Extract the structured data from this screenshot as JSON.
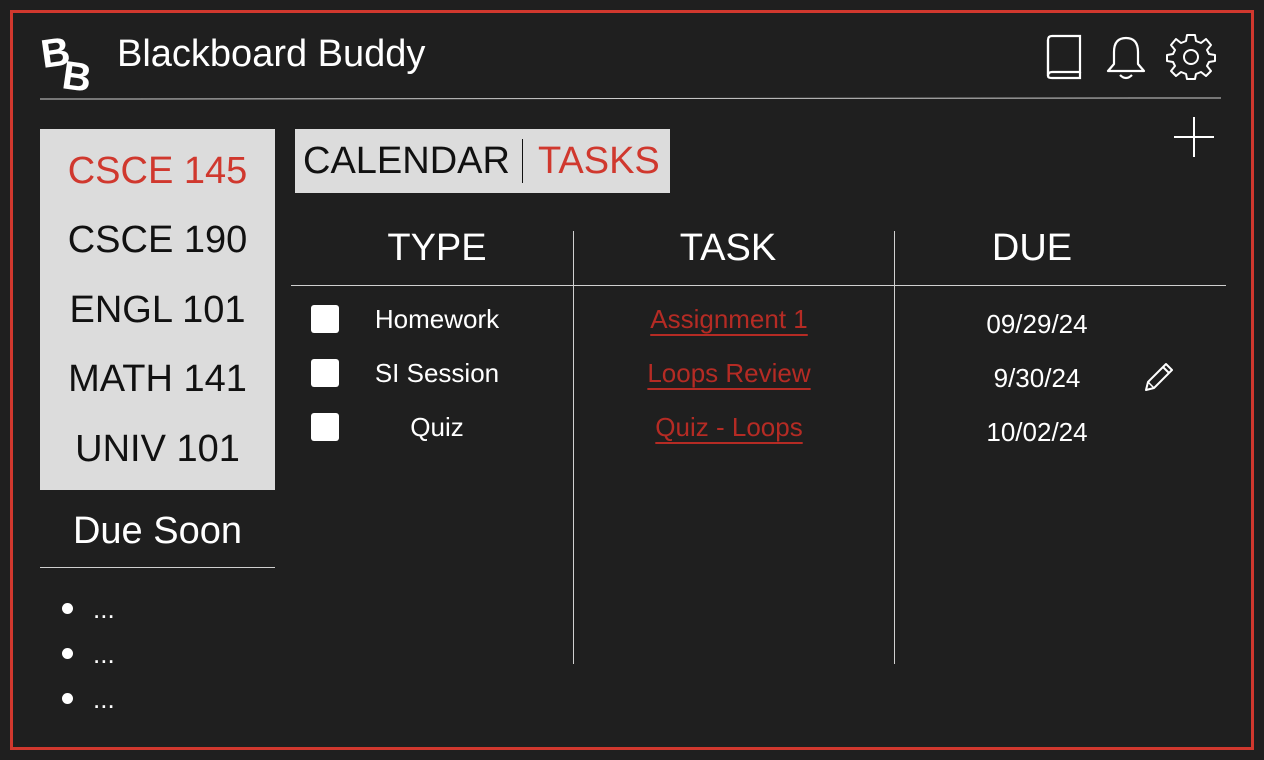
{
  "app": {
    "title": "Blackboard Buddy",
    "accent_color": "#d0382e",
    "logo_letters": "BB"
  },
  "header": {
    "icons": [
      "book-icon",
      "bell-icon",
      "gear-icon"
    ]
  },
  "courses": [
    {
      "label": "CSCE 145",
      "active": true
    },
    {
      "label": "CSCE 190",
      "active": false
    },
    {
      "label": "ENGL 101",
      "active": false
    },
    {
      "label": "MATH 141",
      "active": false
    },
    {
      "label": "UNIV 101",
      "active": false
    }
  ],
  "due_soon": {
    "title": "Due Soon",
    "items": [
      "...",
      "...",
      "..."
    ]
  },
  "tabs": [
    {
      "label": "CALENDAR",
      "active": false
    },
    {
      "label": "TASKS",
      "active": true
    }
  ],
  "table": {
    "headers": [
      "TYPE",
      "TASK",
      "DUE"
    ],
    "rows": [
      {
        "type": "Homework",
        "task": "Assignment 1",
        "due": "09/29/24",
        "checked": false
      },
      {
        "type": "SI Session",
        "task": "Loops Review",
        "due": "9/30/24",
        "checked": false
      },
      {
        "type": "Quiz",
        "task": "Quiz - Loops",
        "due": "10/02/24",
        "checked": false
      }
    ]
  }
}
